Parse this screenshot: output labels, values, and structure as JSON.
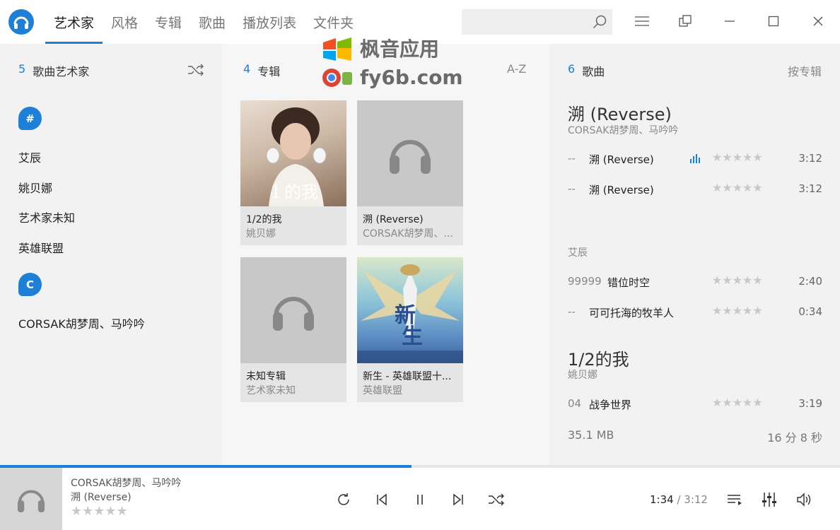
{
  "header": {
    "tabs": [
      "艺术家",
      "风格",
      "专辑",
      "歌曲",
      "播放列表",
      "文件夹"
    ],
    "active_tab": 0
  },
  "artists_col": {
    "count": "5",
    "label": "歌曲艺术家",
    "groups": [
      {
        "letter": "#",
        "items": [
          "艾辰",
          "姚贝娜",
          "艺术家未知",
          "英雄联盟"
        ]
      },
      {
        "letter": "C",
        "items": [
          "CORSAK胡梦周、马吟吟"
        ]
      }
    ]
  },
  "albums_col": {
    "count": "4",
    "label": "专辑",
    "sort": "A-Z",
    "albums": [
      {
        "title": "1/2的我",
        "artist": "姚贝娜"
      },
      {
        "title": "溯 (Reverse)",
        "artist": "CORSAK胡梦周、..."
      },
      {
        "title": "未知专辑",
        "artist": "艺术家未知"
      },
      {
        "title": "新生 - 英雄联盟十...",
        "artist": "英雄联盟"
      }
    ]
  },
  "songs_col": {
    "count": "6",
    "label": "歌曲",
    "sort": "按专辑",
    "groups": [
      {
        "title": "溯 (Reverse)",
        "sub": "CORSAK胡梦周、马吟吟",
        "songs": [
          {
            "track": "--",
            "name": "溯 (Reverse)",
            "duration": "3:12",
            "playing": true
          },
          {
            "track": "--",
            "name": "溯 (Reverse)",
            "duration": "3:12",
            "playing": false
          }
        ]
      },
      {
        "title": "",
        "sub": "艾辰",
        "songs": [
          {
            "track": "99999",
            "name": "错位时空",
            "duration": "2:40",
            "playing": false
          },
          {
            "track": "--",
            "name": "可可托海的牧羊人",
            "duration": "0:34",
            "playing": false
          }
        ]
      },
      {
        "title": "1/2的我",
        "sub": "姚贝娜",
        "songs": [
          {
            "track": "04",
            "name": "战争世界",
            "duration": "3:19",
            "playing": false
          }
        ]
      }
    ],
    "total_size": "35.1 MB",
    "total_time": "16 分 8 秒"
  },
  "player": {
    "artist": "CORSAK胡梦周、马吟吟",
    "title": "溯 (Reverse)",
    "elapsed": "1:34",
    "separator": " / ",
    "total": "3:12",
    "progress": 0.49
  },
  "stars": "★★★★★",
  "watermark": {
    "line1": "枫音应用",
    "line2": "fy6b.com"
  },
  "colors": {
    "accent": "#1e7fd6"
  }
}
